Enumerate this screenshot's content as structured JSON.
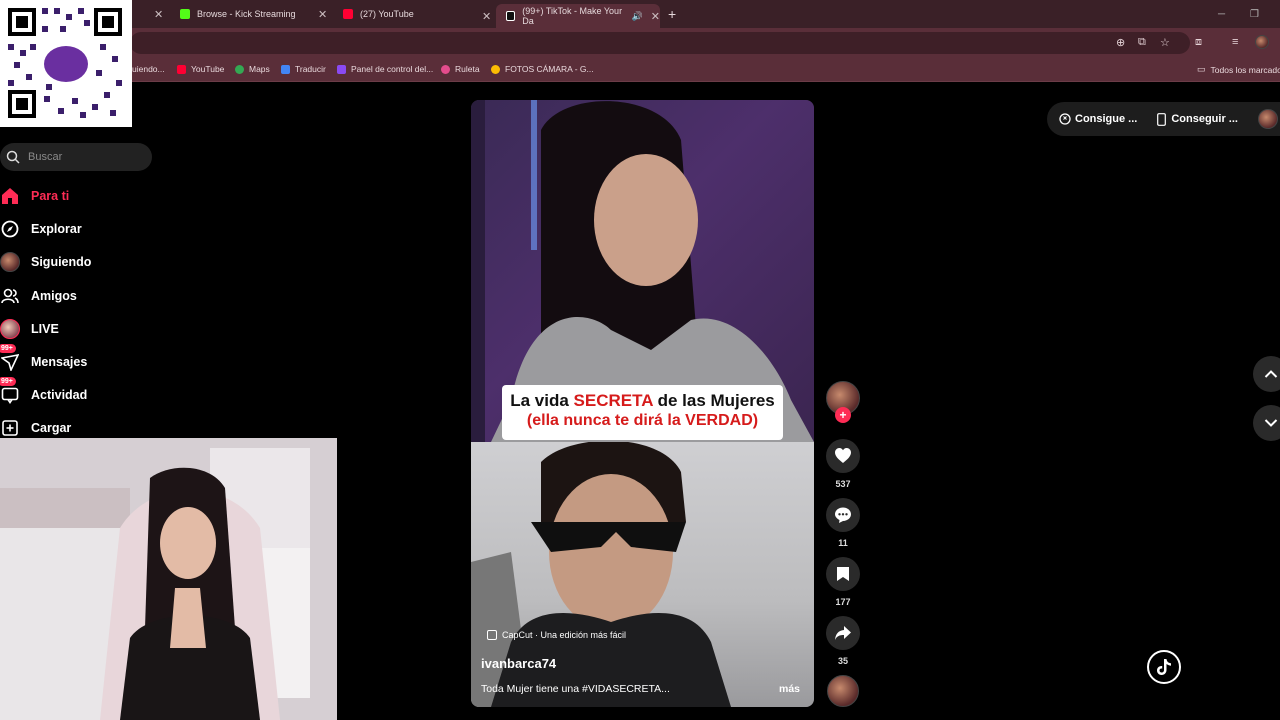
{
  "browser": {
    "tabs": [
      {
        "title": "Browse - Kick Streaming",
        "icon": "kick-icon",
        "color": "#53fc18"
      },
      {
        "title": "(27) YouTube",
        "icon": "youtube-icon",
        "color": "#ff0033"
      },
      {
        "title": "(99+) TikTok - Make Your Da",
        "icon": "tiktok-icon",
        "color": "#ffffff"
      }
    ],
    "new_tab": "+",
    "bookmarks": [
      {
        "label": "uiendo...",
        "color": "#fe2c55"
      },
      {
        "label": "YouTube",
        "color": "#ff0033"
      },
      {
        "label": "Maps",
        "color": "#34a853"
      },
      {
        "label": "Traducir",
        "color": "#4285f4"
      },
      {
        "label": "Panel de control del...",
        "color": "#8a4af3"
      },
      {
        "label": "Ruleta",
        "color": "#e34c8c"
      },
      {
        "label": "FOTOS CÁMARA - G...",
        "color": "#fbbc04"
      }
    ],
    "all_bookmarks": "Todos los marcado"
  },
  "qr": {
    "brand": "yape"
  },
  "sidebar": {
    "search_placeholder": "Buscar",
    "items": [
      {
        "label": "Para ti",
        "icon": "home-icon",
        "active": true
      },
      {
        "label": "Explorar",
        "icon": "compass-icon"
      },
      {
        "label": "Siguiendo",
        "icon": "avatar-icon"
      },
      {
        "label": "Amigos",
        "icon": "friends-icon"
      },
      {
        "label": "LIVE",
        "icon": "live-avatar-icon"
      },
      {
        "label": "Mensajes",
        "icon": "messages-icon",
        "badge": "99+"
      },
      {
        "label": "Actividad",
        "icon": "activity-icon",
        "badge": "99+"
      },
      {
        "label": "Cargar",
        "icon": "upload-icon"
      }
    ]
  },
  "video": {
    "caption_line1_a": "La vida ",
    "caption_line1_b": "SECRETA",
    "caption_line1_c": " de las Mujeres",
    "caption_line2": "(ella nunca te dirá la VERDAD)",
    "capcut": "CapCut · Una edición más fácil",
    "username": "ivanbarca74",
    "description": "Toda Mujer tiene una #VIDASECRETA...",
    "more": "más"
  },
  "actions": {
    "likes": "537",
    "comments": "11",
    "saves": "177",
    "shares": "35"
  },
  "top_right": {
    "get_coins": "Consigue ...",
    "get_app": "Conseguir ..."
  },
  "colors": {
    "accent": "#fe2c55"
  }
}
